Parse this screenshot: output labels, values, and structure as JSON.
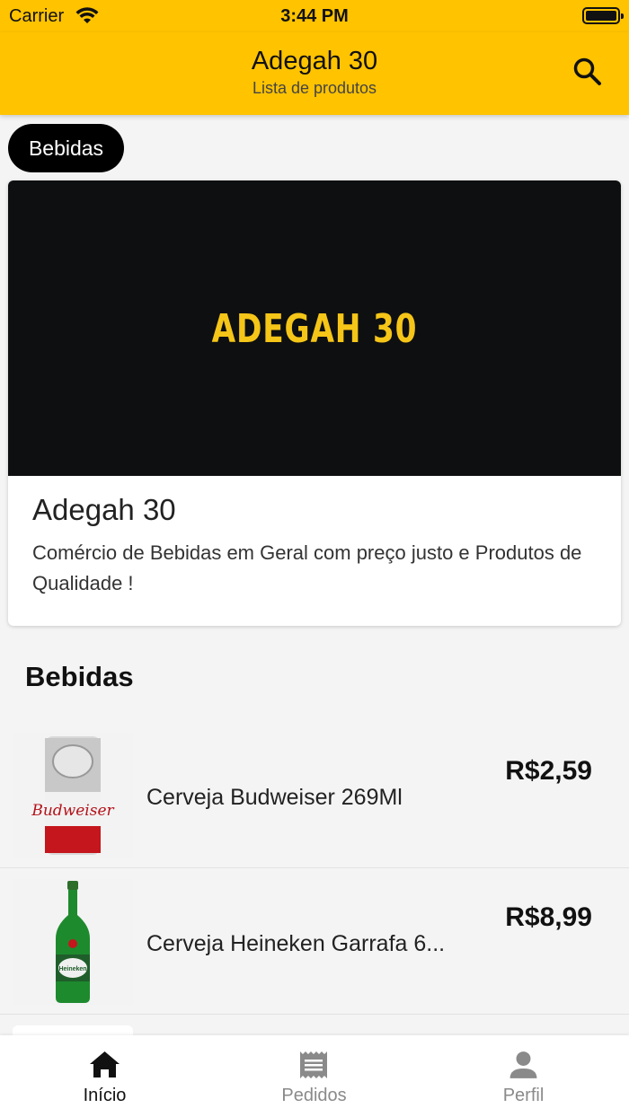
{
  "status_bar": {
    "carrier": "Carrier",
    "time": "3:44 PM"
  },
  "header": {
    "title": "Adegah 30",
    "subtitle": "Lista de produtos",
    "search_icon": "search-icon"
  },
  "category_chip": {
    "label": "Bebidas"
  },
  "store": {
    "banner_logo": "ADEGAH 30",
    "name": "Adegah 30",
    "description": "Comércio de Bebidas em Geral com preço justo e Produtos de Qualidade !"
  },
  "section": {
    "title": "Bebidas"
  },
  "products": [
    {
      "name": "Cerveja Budweiser 269Ml",
      "price": "R$2,59",
      "thumb_icon": "budweiser-can-image"
    },
    {
      "name": "Cerveja Heineken Garrafa 6...",
      "price": "R$8,99",
      "thumb_icon": "heineken-bottle-image"
    }
  ],
  "tabs": [
    {
      "label": "Início",
      "icon": "home-icon",
      "active": true
    },
    {
      "label": "Pedidos",
      "icon": "receipt-icon",
      "active": false
    },
    {
      "label": "Perfil",
      "icon": "person-icon",
      "active": false
    }
  ],
  "colors": {
    "primary": "#ffc300",
    "banner_bg": "#0e0f10",
    "logo_yellow": "#f5c518",
    "inactive_tab": "#8a8a8a"
  }
}
